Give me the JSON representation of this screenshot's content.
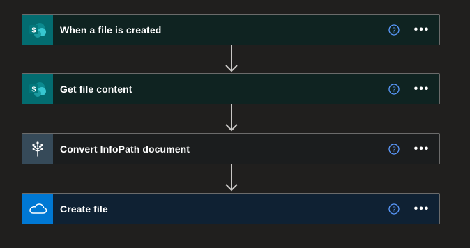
{
  "flow": {
    "steps": [
      {
        "title": "When a file is created",
        "icon": "sharepoint-icon",
        "accent": "#036c70"
      },
      {
        "title": "Get file content",
        "icon": "sharepoint-icon",
        "accent": "#036c70"
      },
      {
        "title": "Convert InfoPath document",
        "icon": "infopath-converter-icon",
        "accent": "#364a59"
      },
      {
        "title": "Create file",
        "icon": "onedrive-icon",
        "accent": "#0078d4"
      }
    ],
    "help_icon_color": "#5b9bff",
    "more_label": "•••"
  }
}
